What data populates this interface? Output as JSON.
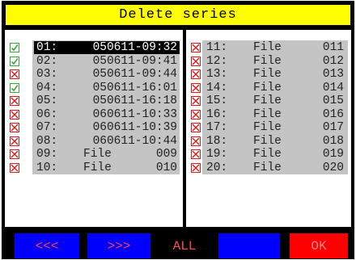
{
  "title": "Delete series",
  "left_list": [
    {
      "num": "01:",
      "label": "050611-09:32",
      "checked": true,
      "selected": true
    },
    {
      "num": "02:",
      "label": "050611-09:41",
      "checked": true,
      "selected": false
    },
    {
      "num": "03:",
      "label": "050611-09:44",
      "checked": false,
      "selected": false
    },
    {
      "num": "04:",
      "label": "050611-16:01",
      "checked": true,
      "selected": false
    },
    {
      "num": "05:",
      "label": "050611-16:18",
      "checked": false,
      "selected": false
    },
    {
      "num": "06:",
      "label": "060611-10:33",
      "checked": false,
      "selected": false
    },
    {
      "num": "07:",
      "label": "060611-10:39",
      "checked": false,
      "selected": false
    },
    {
      "num": "08:",
      "label": "060611-10:44",
      "checked": false,
      "selected": false
    },
    {
      "num": "09:",
      "label": "File 009",
      "checked": false,
      "selected": false
    },
    {
      "num": "10:",
      "label": "File 010",
      "checked": false,
      "selected": false
    }
  ],
  "right_list": [
    {
      "num": "11:",
      "label": "File 011",
      "checked": false
    },
    {
      "num": "12:",
      "label": "File 012",
      "checked": false
    },
    {
      "num": "13:",
      "label": "File 013",
      "checked": false
    },
    {
      "num": "14:",
      "label": "File 014",
      "checked": false
    },
    {
      "num": "15:",
      "label": "File 015",
      "checked": false
    },
    {
      "num": "16:",
      "label": "File 016",
      "checked": false
    },
    {
      "num": "17:",
      "label": "File 017",
      "checked": false
    },
    {
      "num": "18:",
      "label": "File 018",
      "checked": false
    },
    {
      "num": "19:",
      "label": "File 019",
      "checked": false
    },
    {
      "num": "20:",
      "label": "File 020",
      "checked": false
    }
  ],
  "buttons": {
    "prev": "<<<",
    "next": ">>>",
    "all": "ALL",
    "blank": "",
    "ok": "OK"
  },
  "icons": {
    "checked": "check-icon",
    "unchecked": "cross-icon"
  },
  "colors": {
    "title_bg": "#ffff00",
    "button_bg": "#0000ff",
    "ok_bg": "#ff0000",
    "button_text": "#ff4040",
    "selected_bg": "#000000",
    "checked": "#3aa53a",
    "unchecked": "#d31b1b"
  }
}
